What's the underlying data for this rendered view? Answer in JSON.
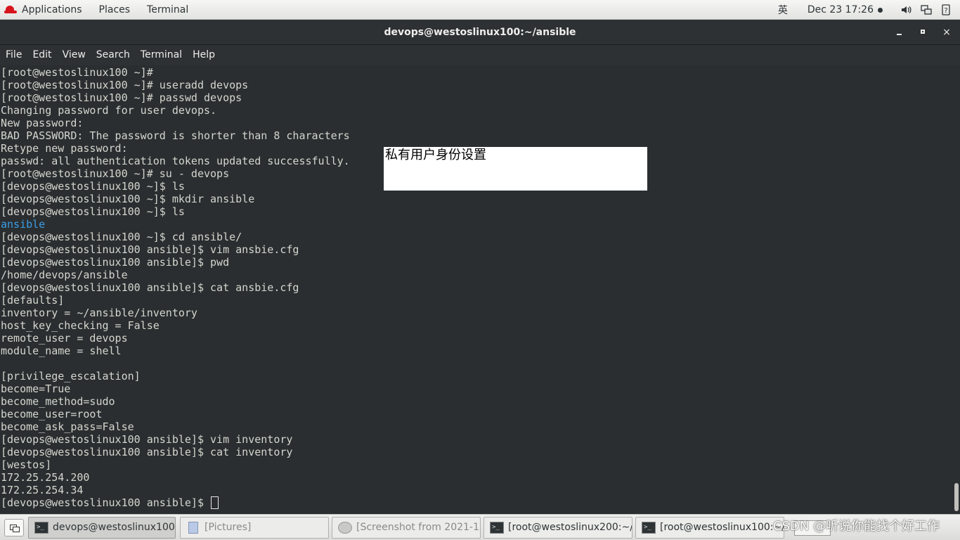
{
  "topbar": {
    "applications": "Applications",
    "places": "Places",
    "terminal": "Terminal",
    "input_method": "英",
    "clock": "Dec 23  17:26",
    "icons": [
      "redhat-logo-icon",
      "volume-icon",
      "network-icon",
      "power-icon"
    ]
  },
  "window": {
    "title": "devops@westoslinux100:~/ansible",
    "minimize_label": "",
    "maximize_label": "",
    "close_label": "×"
  },
  "menubar": {
    "items": [
      "File",
      "Edit",
      "View",
      "Search",
      "Terminal",
      "Help"
    ]
  },
  "terminal": {
    "lines": [
      "[root@westoslinux100 ~]#",
      "[root@westoslinux100 ~]# useradd devops",
      "[root@westoslinux100 ~]# passwd devops",
      "Changing password for user devops.",
      "New password:",
      "BAD PASSWORD: The password is shorter than 8 characters",
      "Retype new password:",
      "passwd: all authentication tokens updated successfully.",
      "[root@westoslinux100 ~]# su - devops",
      "[devops@westoslinux100 ~]$ ls",
      "[devops@westoslinux100 ~]$ mkdir ansible",
      "[devops@westoslinux100 ~]$ ls",
      "ansible",
      "[devops@westoslinux100 ~]$ cd ansible/",
      "[devops@westoslinux100 ansible]$ vim ansbie.cfg",
      "[devops@westoslinux100 ansible]$ pwd",
      "/home/devops/ansible",
      "[devops@westoslinux100 ansible]$ cat ansbie.cfg",
      "[defaults]",
      "inventory = ~/ansible/inventory",
      "host_key_checking = False",
      "remote_user = devops",
      "module_name = shell",
      "",
      "[privilege_escalation]",
      "become=True",
      "become_method=sudo",
      "become_user=root",
      "become_ask_pass=False",
      "[devops@westoslinux100 ansible]$ vim inventory",
      "[devops@westoslinux100 ansible]$ cat inventory",
      "[westos]",
      "172.25.254.200",
      "172.25.254.34",
      "[devops@westoslinux100 ansible]$ "
    ],
    "directory_color": "#3a9ee8",
    "text_color": "#d3d7cf",
    "background": "#2b2e30"
  },
  "overlay_note": {
    "text": "私有用户身份设置"
  },
  "taskbar": {
    "tasks": [
      {
        "label": "devops@westoslinux100:~...",
        "icon": "terminal-icon",
        "state": "active"
      },
      {
        "label": "[Pictures]",
        "icon": "folder-icon",
        "state": "minimized"
      },
      {
        "label": "[Screenshot from 2021-12...",
        "icon": "screenshot-icon",
        "state": "minimized"
      },
      {
        "label": "[root@westoslinux200:~/.a...",
        "icon": "terminal-icon",
        "state": "normal"
      },
      {
        "label": "[root@westoslinux100:~/.a...",
        "icon": "terminal-icon",
        "state": "normal"
      }
    ]
  },
  "watermark": {
    "text": "CSDN @听说你能找个好工作"
  }
}
